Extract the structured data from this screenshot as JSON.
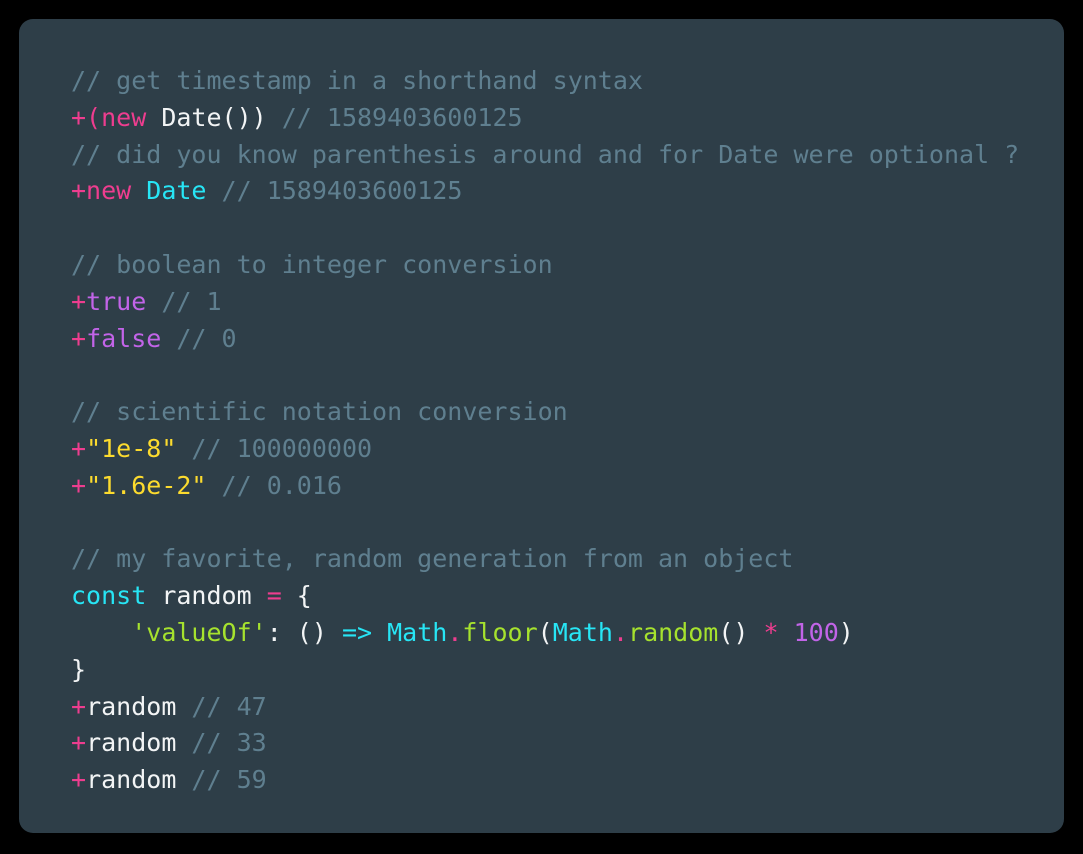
{
  "window": {
    "background_color": "#000000",
    "panel_color": "#2e3e48",
    "corner_radius": "14px"
  },
  "theme": {
    "comment": "#5f7f8f",
    "operator": "#ee3d8f",
    "keyword": "#ee3d8f",
    "boolean": "#c264e8",
    "number": "#c264e8",
    "type": "#27e5f5",
    "string": "#fcdb2e",
    "property": "#a6e22e",
    "plain": "#f2f4f5"
  },
  "code": {
    "language": "javascript",
    "lines": [
      {
        "index": 1,
        "text": "// get timestamp in a shorthand syntax",
        "tokens": [
          {
            "text": "// get timestamp in a shorthand syntax",
            "kind": "comment"
          }
        ]
      },
      {
        "index": 2,
        "text": "+(new Date()) // 1589403600125",
        "tokens": [
          {
            "text": "+(",
            "kind": "operator"
          },
          {
            "text": "new",
            "kind": "keyword"
          },
          {
            "text": " Date())",
            "kind": "plain"
          },
          {
            "text": " // 1589403600125",
            "kind": "comment"
          }
        ]
      },
      {
        "index": 3,
        "text": "// did you know parenthesis around and for Date were optional ?",
        "tokens": [
          {
            "text": "// did you know parenthesis around and for Date were optional ?",
            "kind": "comment"
          }
        ]
      },
      {
        "index": 4,
        "text": "+new Date // 1589403600125",
        "tokens": [
          {
            "text": "+new",
            "kind": "keyword"
          },
          {
            "text": " ",
            "kind": "plain"
          },
          {
            "text": "Date",
            "kind": "type"
          },
          {
            "text": " // 1589403600125",
            "kind": "comment"
          }
        ]
      },
      {
        "index": 5,
        "text": "",
        "tokens": []
      },
      {
        "index": 6,
        "text": "// boolean to integer conversion",
        "tokens": [
          {
            "text": "// boolean to integer conversion",
            "kind": "comment"
          }
        ]
      },
      {
        "index": 7,
        "text": "+true // 1",
        "tokens": [
          {
            "text": "+",
            "kind": "operator"
          },
          {
            "text": "true",
            "kind": "boolean"
          },
          {
            "text": " // 1",
            "kind": "comment"
          }
        ]
      },
      {
        "index": 8,
        "text": "+false // 0",
        "tokens": [
          {
            "text": "+",
            "kind": "operator"
          },
          {
            "text": "false",
            "kind": "boolean"
          },
          {
            "text": " // 0",
            "kind": "comment"
          }
        ]
      },
      {
        "index": 9,
        "text": "",
        "tokens": []
      },
      {
        "index": 10,
        "text": "// scientific notation conversion",
        "tokens": [
          {
            "text": "// scientific notation conversion",
            "kind": "comment"
          }
        ]
      },
      {
        "index": 11,
        "text": "+\"1e-8\" // 100000000",
        "tokens": [
          {
            "text": "+",
            "kind": "operator"
          },
          {
            "text": "\"1e-8\"",
            "kind": "string"
          },
          {
            "text": " // 100000000",
            "kind": "comment"
          }
        ]
      },
      {
        "index": 12,
        "text": "+\"1.6e-2\" // 0.016",
        "tokens": [
          {
            "text": "+",
            "kind": "operator"
          },
          {
            "text": "\"1.6e-2\"",
            "kind": "string"
          },
          {
            "text": " // 0.016",
            "kind": "comment"
          }
        ]
      },
      {
        "index": 13,
        "text": "",
        "tokens": []
      },
      {
        "index": 14,
        "text": "// my favorite, random generation from an object",
        "tokens": [
          {
            "text": "// my favorite, random generation from an object",
            "kind": "comment"
          }
        ]
      },
      {
        "index": 15,
        "text": "const random = {",
        "tokens": [
          {
            "text": "const",
            "kind": "type"
          },
          {
            "text": " random ",
            "kind": "plain"
          },
          {
            "text": "=",
            "kind": "operator"
          },
          {
            "text": " {",
            "kind": "plain"
          }
        ]
      },
      {
        "index": 16,
        "text": "    'valueOf': () => Math.floor(Math.random() * 100)",
        "tokens": [
          {
            "text": "    ",
            "kind": "plain"
          },
          {
            "text": "'valueOf'",
            "kind": "property"
          },
          {
            "text": ": () ",
            "kind": "plain"
          },
          {
            "text": "=>",
            "kind": "type"
          },
          {
            "text": " ",
            "kind": "plain"
          },
          {
            "text": "Math",
            "kind": "type"
          },
          {
            "text": ".",
            "kind": "operator"
          },
          {
            "text": "floor",
            "kind": "property"
          },
          {
            "text": "(",
            "kind": "plain"
          },
          {
            "text": "Math",
            "kind": "type"
          },
          {
            "text": ".",
            "kind": "operator"
          },
          {
            "text": "random",
            "kind": "property"
          },
          {
            "text": "() ",
            "kind": "plain"
          },
          {
            "text": "*",
            "kind": "operator"
          },
          {
            "text": " ",
            "kind": "plain"
          },
          {
            "text": "100",
            "kind": "number"
          },
          {
            "text": ")",
            "kind": "plain"
          }
        ]
      },
      {
        "index": 17,
        "text": "}",
        "tokens": [
          {
            "text": "}",
            "kind": "plain"
          }
        ]
      },
      {
        "index": 18,
        "text": "+random // 47",
        "tokens": [
          {
            "text": "+",
            "kind": "operator"
          },
          {
            "text": "random",
            "kind": "plain"
          },
          {
            "text": " // 47",
            "kind": "comment"
          }
        ]
      },
      {
        "index": 19,
        "text": "+random // 33",
        "tokens": [
          {
            "text": "+",
            "kind": "operator"
          },
          {
            "text": "random",
            "kind": "plain"
          },
          {
            "text": " // 33",
            "kind": "comment"
          }
        ]
      },
      {
        "index": 20,
        "text": "+random // 59",
        "tokens": [
          {
            "text": "+",
            "kind": "operator"
          },
          {
            "text": "random",
            "kind": "plain"
          },
          {
            "text": " // 59",
            "kind": "comment"
          }
        ]
      }
    ]
  }
}
